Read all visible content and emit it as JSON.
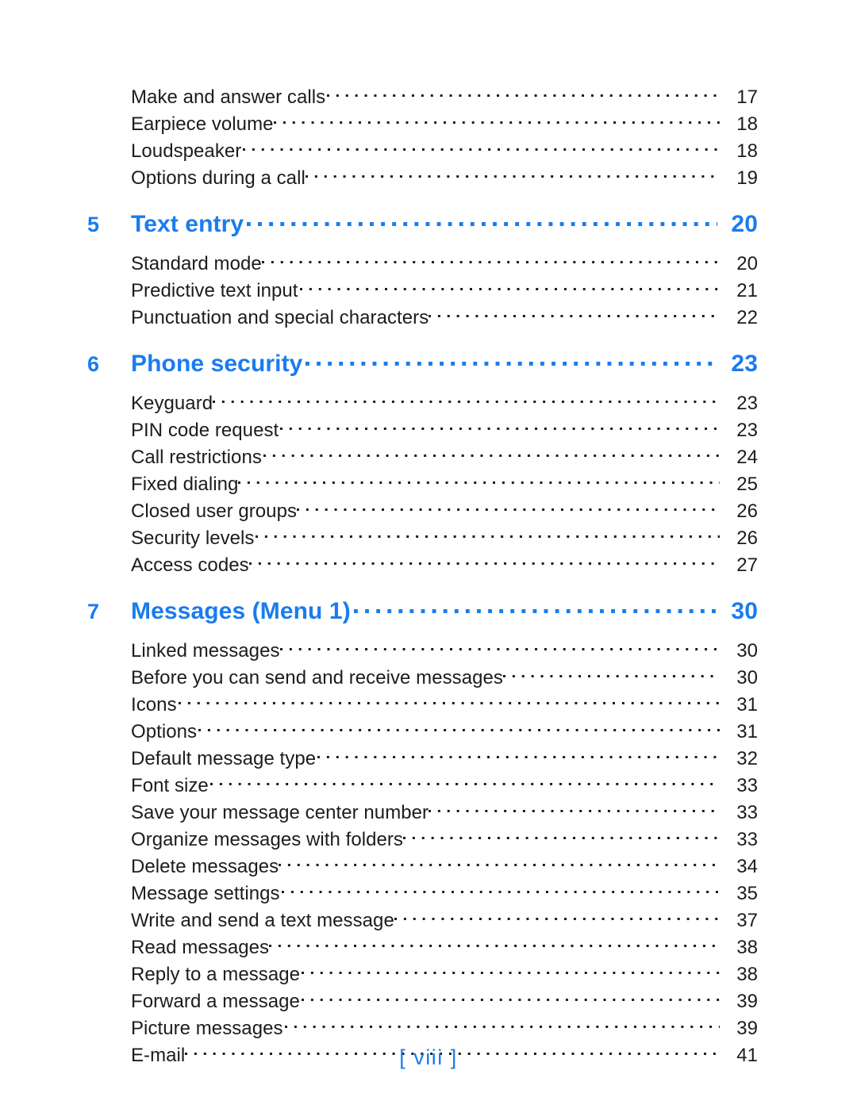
{
  "document": {
    "type": "table-of-contents",
    "folio": "[ viii ]",
    "accent_color": "#1a7cee",
    "text_color": "#1c1c1c",
    "background_color": "#ffffff"
  },
  "toc": {
    "blocks": [
      {
        "kind": "entries",
        "entries": [
          {
            "label": "Make and answer calls",
            "page": "17",
            "tight": false
          },
          {
            "label": "Earpiece volume",
            "page": "18",
            "tight": true
          },
          {
            "label": "Loudspeaker",
            "page": "18",
            "tight": false
          },
          {
            "label": "Options during a call",
            "page": "19",
            "tight": true
          }
        ]
      },
      {
        "kind": "chapter",
        "number": "5",
        "label": "Text entry",
        "page": "20",
        "entries": [
          {
            "label": "Standard mode",
            "page": "20",
            "tight": true
          },
          {
            "label": "Predictive text input",
            "page": "21",
            "tight": false
          },
          {
            "label": "Punctuation and special characters",
            "page": "22",
            "tight": true
          }
        ]
      },
      {
        "kind": "chapter",
        "number": "6",
        "label": "Phone security",
        "page": "23",
        "entries": [
          {
            "label": "Keyguard",
            "page": "23",
            "tight": true
          },
          {
            "label": "PIN code request",
            "page": "23",
            "tight": false
          },
          {
            "label": "Call restrictions",
            "page": "24",
            "tight": false
          },
          {
            "label": "Fixed dialing",
            "page": "25",
            "tight": true
          },
          {
            "label": "Closed user groups",
            "page": "26",
            "tight": true
          },
          {
            "label": "Security levels",
            "page": "26",
            "tight": false
          },
          {
            "label": "Access codes",
            "page": "27",
            "tight": true
          }
        ]
      },
      {
        "kind": "chapter",
        "number": "7",
        "label": "Messages (Menu 1)",
        "page": "30",
        "entries": [
          {
            "label": "Linked messages",
            "page": "30",
            "tight": true
          },
          {
            "label": "Before you can send and receive messages",
            "page": "30",
            "tight": true
          },
          {
            "label": "Icons",
            "page": "31",
            "tight": false
          },
          {
            "label": "Options",
            "page": "31",
            "tight": false
          },
          {
            "label": "Default message type",
            "page": "32",
            "tight": false
          },
          {
            "label": "Font size",
            "page": "33",
            "tight": false
          },
          {
            "label": "Save your message center number",
            "page": "33",
            "tight": true
          },
          {
            "label": "Organize messages with folders",
            "page": "33",
            "tight": true
          },
          {
            "label": "Delete messages",
            "page": "34",
            "tight": true
          },
          {
            "label": "Message settings",
            "page": "35",
            "tight": false
          },
          {
            "label": "Write and send a text message",
            "page": "37",
            "tight": true
          },
          {
            "label": "Read messages",
            "page": "38",
            "tight": true
          },
          {
            "label": "Reply to a message",
            "page": "38",
            "tight": false
          },
          {
            "label": "Forward a message",
            "page": "39",
            "tight": false
          },
          {
            "label": "Picture messages",
            "page": "39",
            "tight": false
          },
          {
            "label": "E-mail",
            "page": "41",
            "tight": true
          }
        ]
      }
    ]
  }
}
